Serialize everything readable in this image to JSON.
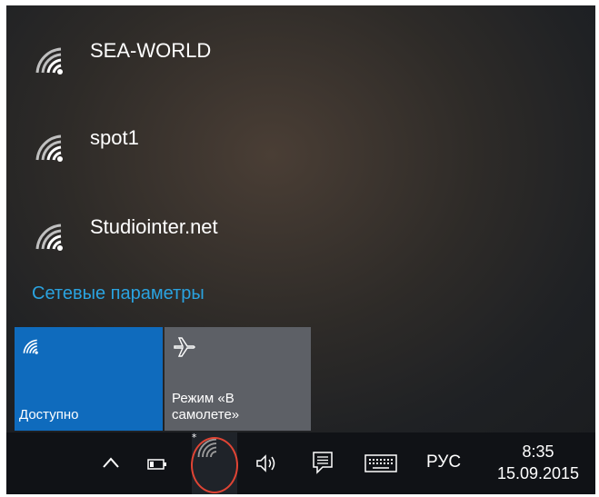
{
  "networks": [
    {
      "name": "SEA-WORLD",
      "icon": "wifi-signal-icon"
    },
    {
      "name": "spot1",
      "icon": "wifi-signal-icon"
    },
    {
      "name": "Studiointer.net",
      "icon": "wifi-signal-icon"
    }
  ],
  "settings_link": "Сетевые параметры",
  "tiles": {
    "wifi": {
      "label": "Доступно",
      "icon": "wifi-signal-icon",
      "color": "#0f6bbd"
    },
    "airplane": {
      "label_line1": "Режим «В",
      "label_line2": "самолете»",
      "icon": "airplane-icon",
      "color": "#5d6066"
    }
  },
  "taskbar": {
    "language": "РУС",
    "time": "8:35",
    "date": "15.09.2015",
    "icons": [
      "chevron-up-icon",
      "battery-icon",
      "wifi-tray-icon",
      "volume-icon",
      "notification-icon",
      "keyboard-icon"
    ]
  },
  "colors": {
    "accent": "#2aa3e0",
    "tile_active": "#0f6bbd",
    "highlight": "#e04434"
  }
}
